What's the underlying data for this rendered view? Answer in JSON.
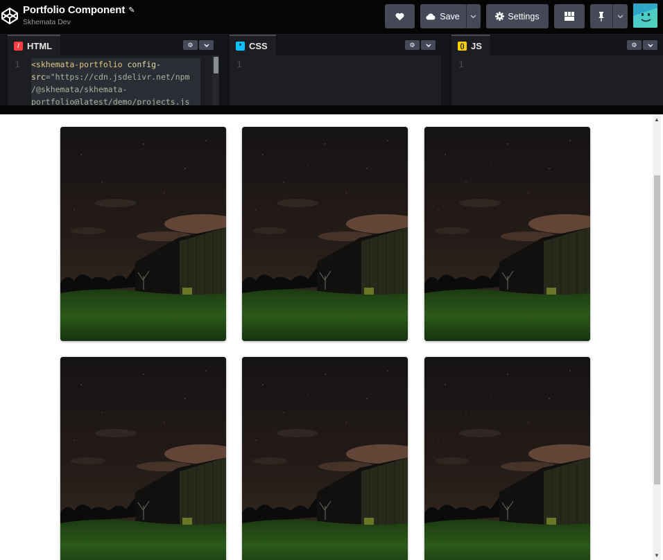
{
  "header": {
    "title": "Portfolio Component",
    "author": "Skhemata Dev",
    "save_label": "Save",
    "settings_label": "Settings"
  },
  "editors": {
    "html": {
      "label": "HTML",
      "line_number": "1",
      "code_lines": [
        {
          "tag": "<skhemata-portfolio",
          "attr": " config-"
        },
        {
          "attr": "src",
          "eq": "=",
          "str": "\"https://cdn.jsdelivr.net/npm"
        },
        {
          "str": "/@skhemata/skhemata-"
        },
        {
          "str": "portfolio@latest/demo/projects.js"
        }
      ]
    },
    "css": {
      "label": "CSS",
      "line_number": "1"
    },
    "js": {
      "label": "JS",
      "line_number": "1"
    }
  },
  "preview": {
    "cards": [
      {
        "name": "portfolio-card-1"
      },
      {
        "name": "portfolio-card-2"
      },
      {
        "name": "portfolio-card-3"
      },
      {
        "name": "portfolio-card-4"
      },
      {
        "name": "portfolio-card-5"
      },
      {
        "name": "portfolio-card-6"
      }
    ]
  },
  "icons": {
    "logo": "codepen-logo-icon",
    "love": "heart-icon",
    "save": "cloud-icon",
    "settings": "gear-icon",
    "layout": "layout-grid-icon",
    "pin": "pin-icon"
  },
  "colors": {
    "header_bg": "#050505",
    "button_bg": "#444857",
    "editor_bg": "#1d1e22",
    "html_accent": "#ff3c41",
    "css_accent": "#0ebeff",
    "js_accent": "#fcd000"
  }
}
